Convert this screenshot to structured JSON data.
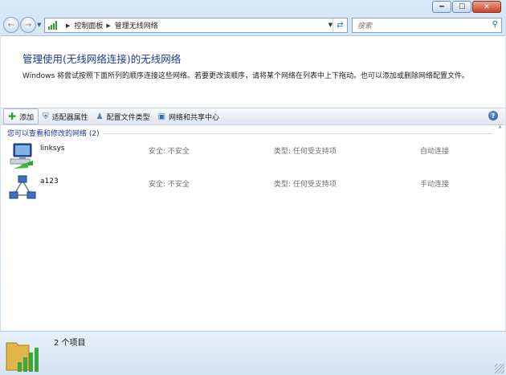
{
  "window": {
    "caption_buttons": [
      "minimize",
      "maximize",
      "close"
    ]
  },
  "address": {
    "breadcrumbs": [
      "控制面板",
      "管理无线网络"
    ],
    "search_placeholder": "搜索"
  },
  "page": {
    "heading": "管理使用(无线网络连接)的无线网络",
    "description": "Windows 将尝试按照下面所列的顺序连接这些网络。若要更改该顺序，请将某个网络在列表中上下拖动。也可以添加或删除网络配置文件。"
  },
  "toolbar": {
    "add": "添加",
    "adapter_properties": "适配器属性",
    "profile_types": "配置文件类型",
    "network_center": "网络和共享中心",
    "help": "?"
  },
  "group": {
    "label": "您可以查看和修改的网络 (2)"
  },
  "networks": [
    {
      "name": "linksys",
      "security": "安全: 不安全",
      "type": "类型: 任何受支持项",
      "mode": "自动连接",
      "icon": "wireless-computer-icon"
    },
    {
      "name": "a123",
      "security": "安全: 不安全",
      "type": "类型: 任何受支持项",
      "mode": "手动连接",
      "icon": "adhoc-network-icon"
    }
  ],
  "status": {
    "count": "2 个项目",
    "icon": "wireless-folder-icon"
  },
  "colors": {
    "link_blue": "#1e3a8f",
    "signal_green": "#3a9a2a",
    "window_frame": "#cfe3f5"
  }
}
